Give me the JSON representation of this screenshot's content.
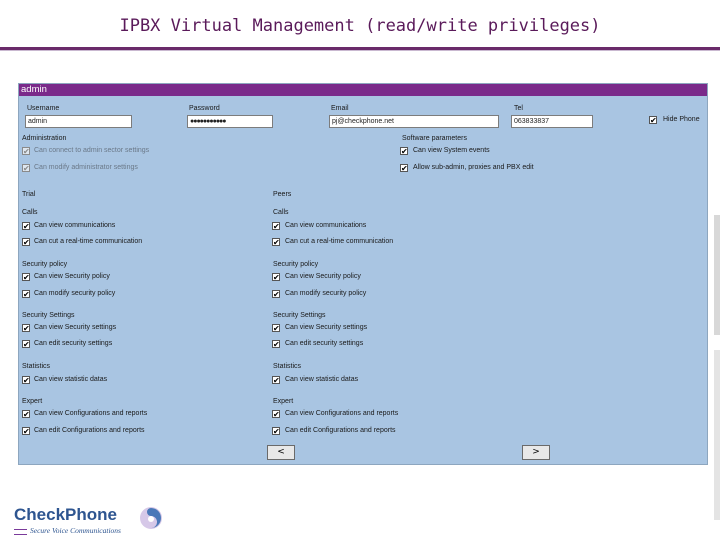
{
  "slide": {
    "title": "IPBX Virtual Management (read/write privileges)"
  },
  "panel": {
    "header": "admin",
    "username": {
      "label": "Username",
      "value": "admin"
    },
    "password": {
      "label": "Password",
      "value": "●●●●●●●●●●●"
    },
    "email": {
      "label": "Email",
      "value": "pj@checkphone.net"
    },
    "tel": {
      "label": "Tel",
      "value": "063833837"
    },
    "hide_phone": {
      "label": "Hide Phone",
      "checked": true
    },
    "administration": {
      "title": "Administration",
      "options": [
        {
          "label": "Can connect to admin sector settings",
          "checked": true,
          "dim": true
        },
        {
          "label": "Can modify administrator settings",
          "checked": true,
          "dim": true
        }
      ]
    },
    "software_parameters": {
      "title": "Software parameters",
      "options": [
        {
          "label": "Can view System events",
          "checked": true
        },
        {
          "label": "Allow sub-admin, proxies and PBX edit",
          "checked": true
        }
      ]
    },
    "columns": [
      {
        "title": "Trial",
        "sections": [
          {
            "title": "Calls",
            "options": [
              "Can view communications",
              "Can cut a real-time communication"
            ]
          },
          {
            "title": "Security policy",
            "options": [
              "Can view Security policy",
              "Can modify security policy"
            ]
          },
          {
            "title": "Security Settings",
            "options": [
              "Can view Security settings",
              "Can edit security settings"
            ]
          },
          {
            "title": "Statistics",
            "options": [
              "Can view statistic datas"
            ]
          },
          {
            "title": "Expert",
            "options": [
              "Can view Configurations and reports",
              "Can edit Configurations and reports"
            ]
          }
        ]
      },
      {
        "title": "Peers",
        "sections": [
          {
            "title": "Calls",
            "options": [
              "Can view communications",
              "Can cut a real-time communication"
            ]
          },
          {
            "title": "Security policy",
            "options": [
              "Can view Security policy",
              "Can modify security policy"
            ]
          },
          {
            "title": "Security Settings",
            "options": [
              "Can view Security settings",
              "Can edit security settings"
            ]
          },
          {
            "title": "Statistics",
            "options": [
              "Can view statistic datas"
            ]
          },
          {
            "title": "Expert",
            "options": [
              "Can view Configurations and reports",
              "Can edit Configurations and reports"
            ]
          }
        ]
      }
    ],
    "nav": {
      "prev": "<",
      "next": ">"
    }
  },
  "logo": {
    "name": "CheckPhone",
    "tagline": "Secure Voice Communications"
  }
}
